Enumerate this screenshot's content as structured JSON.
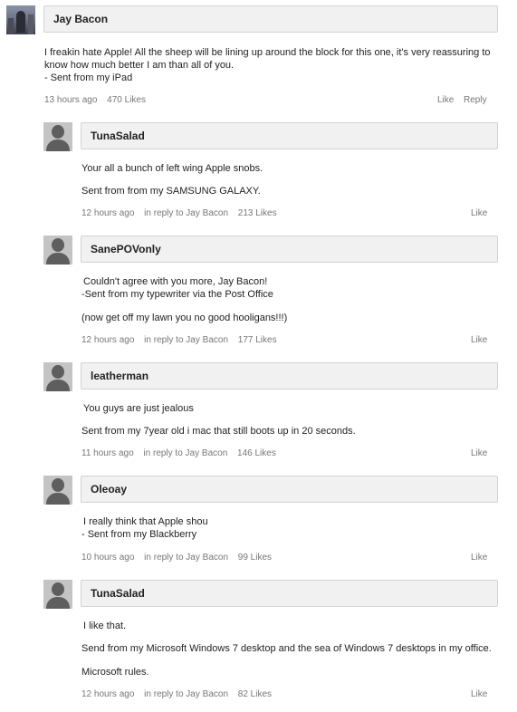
{
  "comments": [
    {
      "username": "Jay Bacon",
      "avatar": "user-photo-avatar",
      "lines": [
        "I freakin hate Apple! All the sheep will be lining up around the block for this one, it's very reassuring to",
        "know how much better I am than all of you.",
        "- Sent from my iPad"
      ],
      "time": "13 hours ago",
      "likes": "470 Likes",
      "like_label": "Like",
      "reply_label": "Reply"
    },
    {
      "username": "TunaSalad",
      "avatar": "default-person-icon",
      "lines": [
        "Your all a bunch of left wing Apple snobs.",
        "Sent from from my SAMSUNG GALAXY."
      ],
      "time": "12 hours ago",
      "in_reply_to": "in reply to Jay Bacon",
      "likes": "213 Likes",
      "like_label": "Like"
    },
    {
      "username": "SanePOVonly",
      "avatar": "default-person-icon",
      "lines": [
        "Couldn't agree with you more, Jay Bacon!",
        "-Sent from my typewriter via the Post Office",
        "(now get off my lawn you no good hooligans!!!)"
      ],
      "time": "12 hours ago",
      "in_reply_to": "in reply to Jay Bacon",
      "likes": "177 Likes",
      "like_label": "Like"
    },
    {
      "username": "leatherman",
      "avatar": "default-person-icon",
      "lines": [
        "You guys are just jealous",
        "Sent from my 7year old i mac that still boots up in 20 seconds."
      ],
      "time": "11 hours ago",
      "in_reply_to": "in reply to Jay Bacon",
      "likes": "146 Likes",
      "like_label": "Like"
    },
    {
      "username": "Oleoay",
      "avatar": "default-person-icon",
      "lines": [
        "I really think that Apple shou",
        "- Sent from my Blackberry"
      ],
      "time": "10 hours ago",
      "in_reply_to": "in reply to Jay Bacon",
      "likes": "99 Likes",
      "like_label": "Like"
    },
    {
      "username": "TunaSalad",
      "avatar": "default-person-icon",
      "lines": [
        "I like that.",
        "Send from my Microsoft Windows 7 desktop and the sea of Windows 7 desktops in my office.",
        "Microsoft rules."
      ],
      "time": "12 hours ago",
      "in_reply_to": "in reply to Jay Bacon",
      "likes": "82 Likes",
      "like_label": "Like"
    }
  ]
}
